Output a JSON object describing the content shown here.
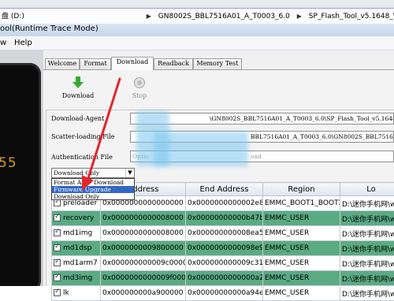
{
  "explorer": {
    "breadcrumb": [
      "GN8002S_BBL7516A01_A_T0003_6.0",
      "SP_Flash_Tool_v5.1648_Win"
    ],
    "drive_fragment": "盘 (D:)"
  },
  "window": {
    "title": "ool(Runtime Trace Mode)",
    "menu": [
      "w",
      "Help"
    ]
  },
  "phone": {
    "clock_digits": "55"
  },
  "tabs": [
    "Welcome",
    "Format",
    "Download",
    "Readback",
    "Memory Test"
  ],
  "active_tab": "Download",
  "toolbar": {
    "download_label": "Download",
    "stop_label": "Stop"
  },
  "fields": {
    "download_agent_label": "Download-Agent",
    "download_agent_value": "\\GN8002S_BBL7516A01_A_T0003_6.0\\SP_Flash_Tool_v5.1648_Win\\MTK_All",
    "scatter_label": "Scatter-loading File",
    "scatter_value": "BBL7516A01_A_T0003_6.0\\GN8002S_BBL7516A01",
    "auth_label": "Authentication File",
    "auth_placeholder_left": "Optio",
    "auth_placeholder_right": "oad"
  },
  "mode_select": {
    "value": "Download Only",
    "options": [
      "Format All + Download",
      "Firmware Upgrade",
      "Download Only"
    ],
    "highlighted": "Firmware Upgrade"
  },
  "table": {
    "headers": [
      "",
      "Address",
      "End Address",
      "Region",
      "Lo"
    ],
    "rows": [
      {
        "name": "preloader",
        "begin": "0x0000000000000000",
        "end": "0x0000000000002e84b",
        "region": "EMMC_BOOT1_BOOT2",
        "location": "D:\\迷你手机网\\www.mi"
      },
      {
        "name": "recovery",
        "begin": "0x0000000000008000",
        "end": "0x00000000000b47b7f",
        "region": "EMMC_USER",
        "location": "D:\\迷你手机网\\www.mi"
      },
      {
        "name": "md1img",
        "begin": "0x0000000000008000",
        "end": "0x000000000008ea54af",
        "region": "EMMC_USER",
        "location": "D:\\迷你手机网\\www.mi"
      },
      {
        "name": "md1dsp",
        "begin": "0x0000000009800000",
        "end": "0x0000000000098e9a8f",
        "region": "EMMC_USER",
        "location": "D:\\迷你手机网\\www.mi"
      },
      {
        "name": "md1arm7",
        "begin": "0x000000000009c00000",
        "end": "0x000000000009c310ff",
        "region": "EMMC_USER",
        "location": "D:\\迷你手机网\\www.mi"
      },
      {
        "name": "md3img",
        "begin": "0x0000000000009f00000",
        "end": "0x0000000000000a2d4bdf",
        "region": "EMMC_USER",
        "location": "D:\\迷你手机网\\www.mi"
      },
      {
        "name": "lk",
        "begin": "0x000000000a900000",
        "end": "0x00000000000a94e31f",
        "region": "EMMC_USER",
        "location": "D:\\迷你手机网\\www.mi"
      }
    ]
  },
  "colors": {
    "row_highlight": "#5aab83",
    "annotation_arrow": "#e2262b",
    "selected_option": "#3169c6"
  }
}
